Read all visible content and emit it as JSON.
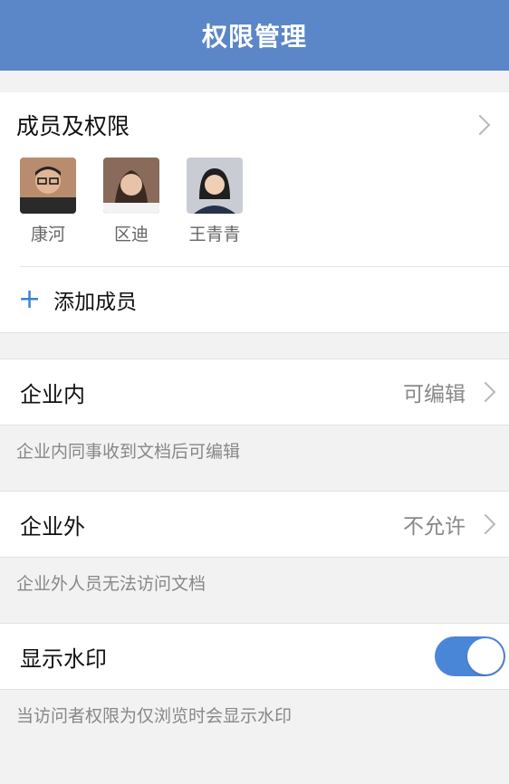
{
  "header": {
    "title": "权限管理"
  },
  "members": {
    "title": "成员及权限",
    "list": [
      {
        "name": "康河"
      },
      {
        "name": "区迪"
      },
      {
        "name": "王青青"
      }
    ],
    "add_label": "添加成员"
  },
  "settings": [
    {
      "label": "企业内",
      "value": "可编辑",
      "desc": "企业内同事收到文档后可编辑"
    },
    {
      "label": "企业外",
      "value": "不允许",
      "desc": "企业外人员无法访问文档"
    }
  ],
  "watermark": {
    "label": "显示水印",
    "enabled": true,
    "desc": "当访问者权限为仅浏览时会显示水印"
  },
  "colors": {
    "header": "#5b86c8",
    "accent": "#3f7fd0",
    "toggle": "#4a86d8"
  }
}
